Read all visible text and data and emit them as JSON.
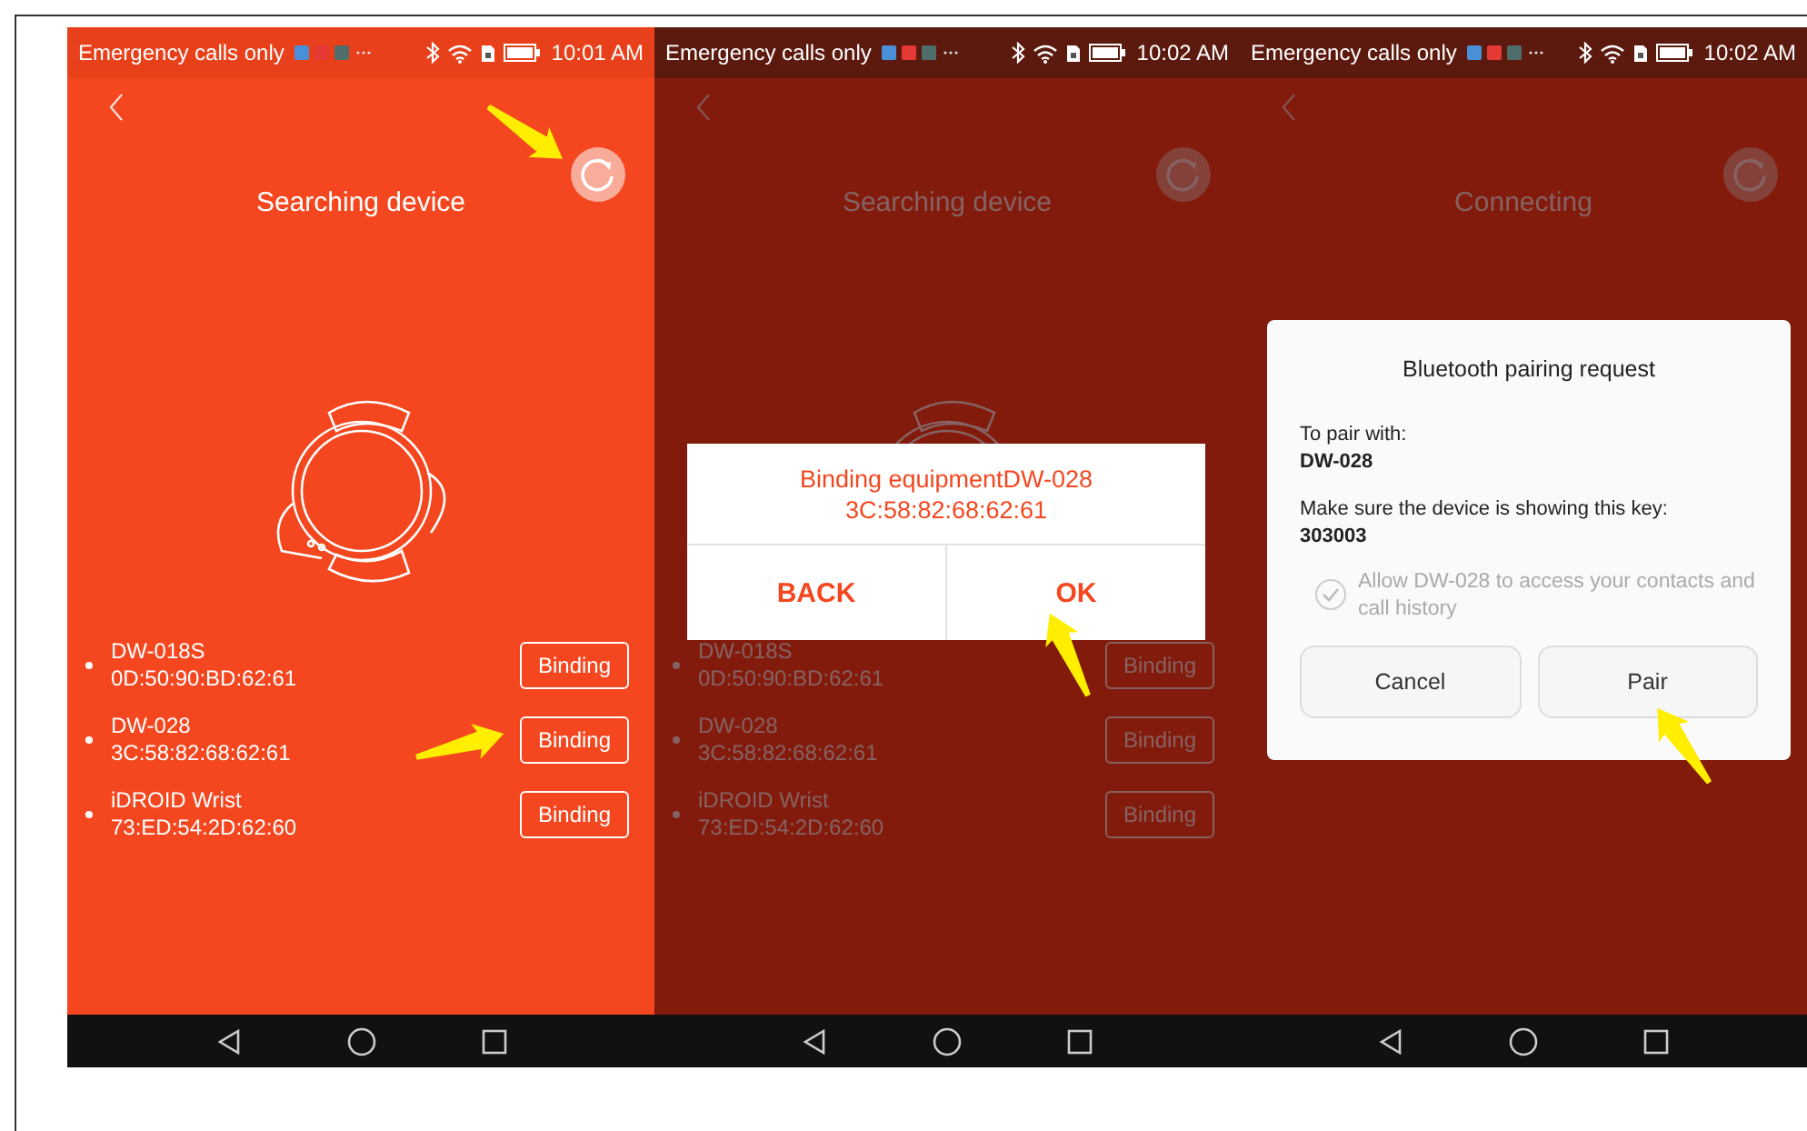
{
  "screens": [
    {
      "status_bar": {
        "carrier": "Emergency calls only",
        "time": "10:01 AM"
      },
      "title": "Searching device",
      "dimmed": false,
      "refresh_pointer": true,
      "devices": [
        {
          "name": "DW-018S",
          "mac": "0D:50:90:BD:62:61",
          "button": "Binding",
          "pointer": false
        },
        {
          "name": "DW-028",
          "mac": "3C:58:82:68:62:61",
          "button": "Binding",
          "pointer": true
        },
        {
          "name": "iDROID Wrist",
          "mac": "73:ED:54:2D:62:60",
          "button": "Binding",
          "pointer": false
        }
      ]
    },
    {
      "status_bar": {
        "carrier": "Emergency calls only",
        "time": "10:02 AM"
      },
      "title": "Searching device",
      "dimmed": true,
      "refresh_pointer": false,
      "devices": [
        {
          "name": "DW-018S",
          "mac": "0D:50:90:BD:62:61",
          "button": "Binding",
          "pointer": false
        },
        {
          "name": "DW-028",
          "mac": "3C:58:82:68:62:61",
          "button": "Binding",
          "pointer": false
        },
        {
          "name": "iDROID Wrist",
          "mac": "73:ED:54:2D:62:60",
          "button": "Binding",
          "pointer": false
        }
      ],
      "dialog": {
        "kind": "binding",
        "message": "Binding equipmentDW-028",
        "mac": "3C:58:82:68:62:61",
        "buttons": [
          {
            "label": "BACK",
            "pointer": false
          },
          {
            "label": "OK",
            "pointer": true
          }
        ]
      }
    },
    {
      "status_bar": {
        "carrier": "Emergency calls only",
        "time": "10:02 AM"
      },
      "title": "Connecting",
      "dimmed": true,
      "refresh_pointer": false,
      "dialog": {
        "kind": "pairing",
        "title": "Bluetooth pairing request",
        "pair_label": "To pair with:",
        "device": "DW-028",
        "key_label": "Make sure the device is showing this key:",
        "key": "303003",
        "consent": {
          "label": "Allow DW-028 to access your contacts and call history",
          "checked": true
        },
        "buttons": [
          {
            "label": "Cancel",
            "pointer": false
          },
          {
            "label": "Pair",
            "pointer": true
          }
        ]
      }
    }
  ]
}
